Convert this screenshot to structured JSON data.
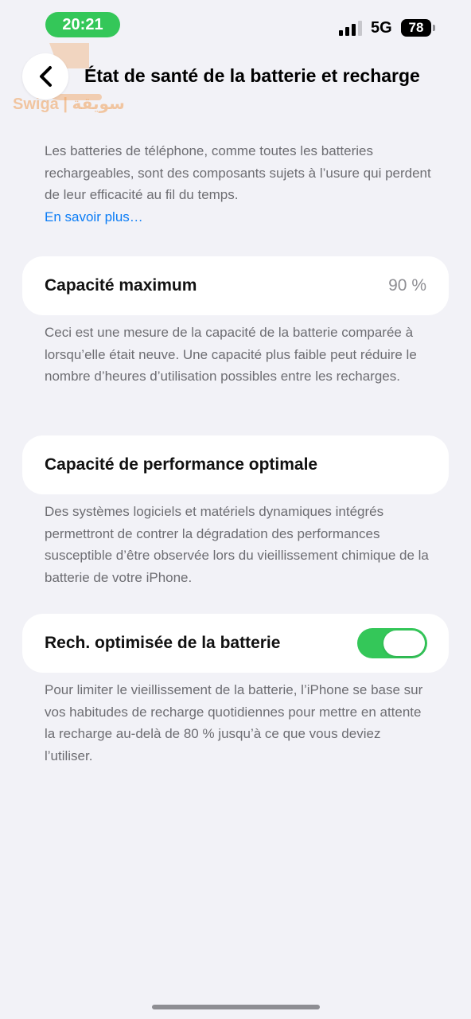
{
  "status_bar": {
    "time": "20:21",
    "network": "5G",
    "battery": "78"
  },
  "nav": {
    "title": "État de santé de la batterie et recharge"
  },
  "watermark": {
    "text": "Swiga | سويقة"
  },
  "intro": {
    "text": "Les batteries de téléphone, comme toutes les batteries rechargeables, sont des composants sujets à l’usure qui perdent de leur efficacité au fil du temps.",
    "link": "En savoir plus…"
  },
  "max_capacity": {
    "label": "Capacité maximum",
    "value": "90 %",
    "footer": "Ceci est une mesure de la capacité de la batterie comparée à lorsqu’elle était neuve. Une capacité plus faible peut réduire le nombre d’heures d’utilisation possibles entre les recharges."
  },
  "performance": {
    "label": "Capacité de performance optimale",
    "footer": "Des systèmes logiciels et matériels dynamiques intégrés permettront de contrer la dégradation des performances susceptible d’être observée lors du vieillissement chimique de la batterie de votre iPhone."
  },
  "optimized_charging": {
    "label": "Rech. optimisée de la batterie",
    "enabled": true,
    "footer": "Pour limiter le vieillissement de la batterie, l’iPhone se base sur vos habitudes de recharge quotidiennes pour mettre en attente la recharge au-delà de 80 % jusqu’à ce que vous deviez l’utiliser."
  },
  "colors": {
    "accent_green": "#34c759",
    "link_blue": "#0a7cf6",
    "background": "#f2f2f7"
  },
  "icons": [
    "back-chevron-icon",
    "signal-icon",
    "battery-icon",
    "watermark-logo-icon"
  ]
}
